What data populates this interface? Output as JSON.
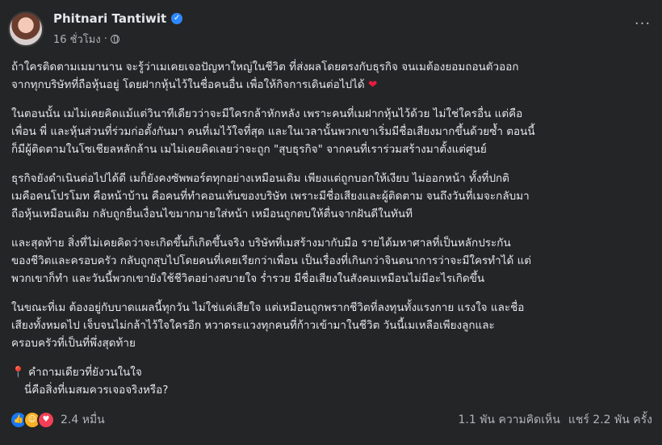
{
  "post": {
    "author": "Phitnari Tantiwit",
    "time": "16 ชั่วโมง",
    "paragraphs": [
      "ถ้าใครติดตามเมมานาน จะรู้ว่าเมเคยเจอปัญหาใหญ่ในชีวิต ที่ส่งผลโดยตรงกับธุรกิจ จนเมต้องยอมถอนตัวออก\nจากทุกบริษัทที่ถือหุ้นอยู่ โดยฝากหุ้นไว้ในชื่อคนอื่น เพื่อให้กิจการเดินต่อไปได้",
      "ในตอนนั้น เมไม่เคยคิดแม้แต่วินาทีเดียวว่าจะมีใครกล้าหักหลัง เพราะคนที่เมฝากหุ้นไว้ด้วย ไม่ใช่ใครอื่น แต่คือ\nเพื่อน พี่ และหุ้นส่วนที่ร่วมก่อตั้งกันมา คนที่เมไว้ใจที่สุด และในเวลานั้นพวกเขาเริ่มมีชื่อเสียงมากขึ้นด้วยซ้ำ ตอนนี้\nก็มีผู้ติดตามในโซเชียลหลักล้าน เมไม่เคยคิดเลยว่าจะถูก \"สุบธุรกิจ\" จากคนที่เราร่วมสร้างมาตั้งแต่ศูนย์",
      "ธุรกิจยังดำเนินต่อไปได้ดี เมก็ยังคงซัพพอร์ตทุกอย่างเหมือนเดิม เพียงแต่ถูกบอกให้เงียบ ไม่ออกหน้า ทั้งที่ปกติ\nเมคือคนโปรโมท คือหน้าบ้าน คือคนที่ทำคอนเท้นของบริษัท เพราะมีชื่อเสียงและผู้ติดตาม จนถึงวันที่เมจะกลับมา\nถือหุ้นเหมือนเดิม กลับถูกยื่นเงื่อนไขมากมายใส่หน้า เหมือนถูกตบให้ตื่นจากฝันดีในทันที",
      "และสุดท้าย สิ่งที่ไม่เคยคิดว่าจะเกิดขึ้นก็เกิดขึ้นจริง บริษัทที่เมสร้างมากับมือ รายได้มหาศาลที่เป็นหลักประกัน\nของชีวิตและครอบครัว กลับถูกสุบไปโดยคนที่เคยเรียกว่าเพื่อน เป็นเรื่องที่เกินกว่าจินตนาการว่าจะมีใครทำได้ แต่\nพวกเขาก็ทำ และวันนี้พวกเขายังใช้ชีวิตอย่างสบายใจ ร่ำรวย มีชื่อเสียงในสังคมเหมือนไม่มีอะไรเกิดขึ้น",
      "ในขณะที่เม ต้องอยู่กับบาดแผลนี้ทุกวัน ไม่ใช่แค่เสียใจ แต่เหมือนถูกพรากชีวิตที่ลงทุนทั้งแรงกาย แรงใจ และชื่อ\nเสียงทั้งหมดไป เจ็บจนไม่กล้าไว้ใจใครอีก หวาดระแวงทุกคนที่ก้าวเข้ามาในชีวิต วันนี้เมเหลือเพียงลูกและ\nครอบครัวที่เป็นที่พึ่งสุดท้าย"
    ],
    "question_line1": "คำถามเดียวที่ยังวนในใจ",
    "question_line2": "นี่คือสิ่งที่เมสมควรเจอจริงหรือ?",
    "reaction_count": "2.4 หมื่น",
    "comments": "1.1 พัน ความคิดเห็น",
    "shares": "แชร์ 2.2 พัน ครั้ง"
  },
  "icons": {
    "verified": "verified-badge-icon",
    "privacy": "globe-icon",
    "more": "more-options-icon",
    "heart": "heart-emoji",
    "pin": "pushpin-emoji",
    "reactions": [
      "like-icon",
      "care-icon",
      "love-icon"
    ]
  },
  "colors": {
    "background": "#242526",
    "text": "#e4e6eb",
    "secondary_text": "#b0b3b8",
    "verified": "#2d88ff",
    "like": "#1877f2",
    "love": "#f33e58",
    "care": "#f7b125"
  }
}
